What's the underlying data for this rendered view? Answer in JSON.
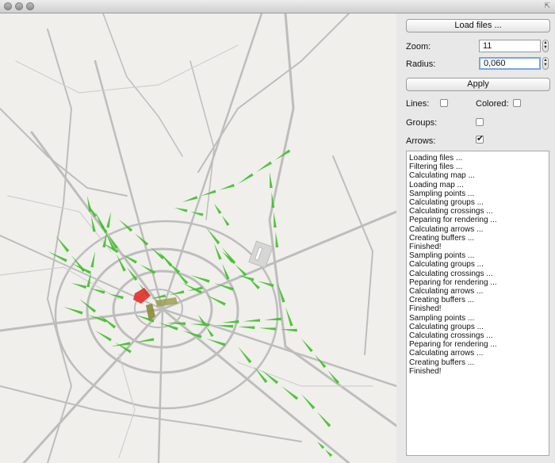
{
  "window": {
    "buttons": [
      "close-icon",
      "minimize-icon",
      "zoom-icon"
    ],
    "resize_icon": "resize-icon"
  },
  "panel": {
    "load_button": "Load files ...",
    "zoom_label": "Zoom:",
    "zoom_value": "11",
    "radius_label": "Radius:",
    "radius_value": "0,060",
    "apply_button": "Apply",
    "lines_label": "Lines:",
    "lines_checked": false,
    "colored_label": "Colored:",
    "colored_checked": false,
    "groups_label": "Groups:",
    "groups_checked": false,
    "arrows_label": "Arrows:",
    "arrows_checked": true
  },
  "log": [
    "Loading files ...",
    "Filtering files ...",
    "Calculating map ...",
    "Loading map ...",
    "Sampling points ...",
    "Calculating groups ...",
    "Calculating crossings ...",
    "Peparing for rendering ...",
    "Calculating arrows ...",
    "Creating buffers ...",
    "Finished!",
    "Sampling points ...",
    "Calculating groups ...",
    "Calculating crossings ...",
    "Peparing for rendering ...",
    "Calculating arrows ...",
    "Creating buffers ...",
    "Finished!",
    "Sampling points ...",
    "Calculating groups ...",
    "Calculating crossings ...",
    "Peparing for rendering ...",
    "Calculating arrows ...",
    "Creating buffers ...",
    "Finished!"
  ],
  "colors": {
    "arrow_green": "#3fbf2a",
    "highlight_red": "#e0302a",
    "highlight_olive": "#8a8a3a",
    "road": "#b8b8b8",
    "map_background": "#f0efec"
  }
}
